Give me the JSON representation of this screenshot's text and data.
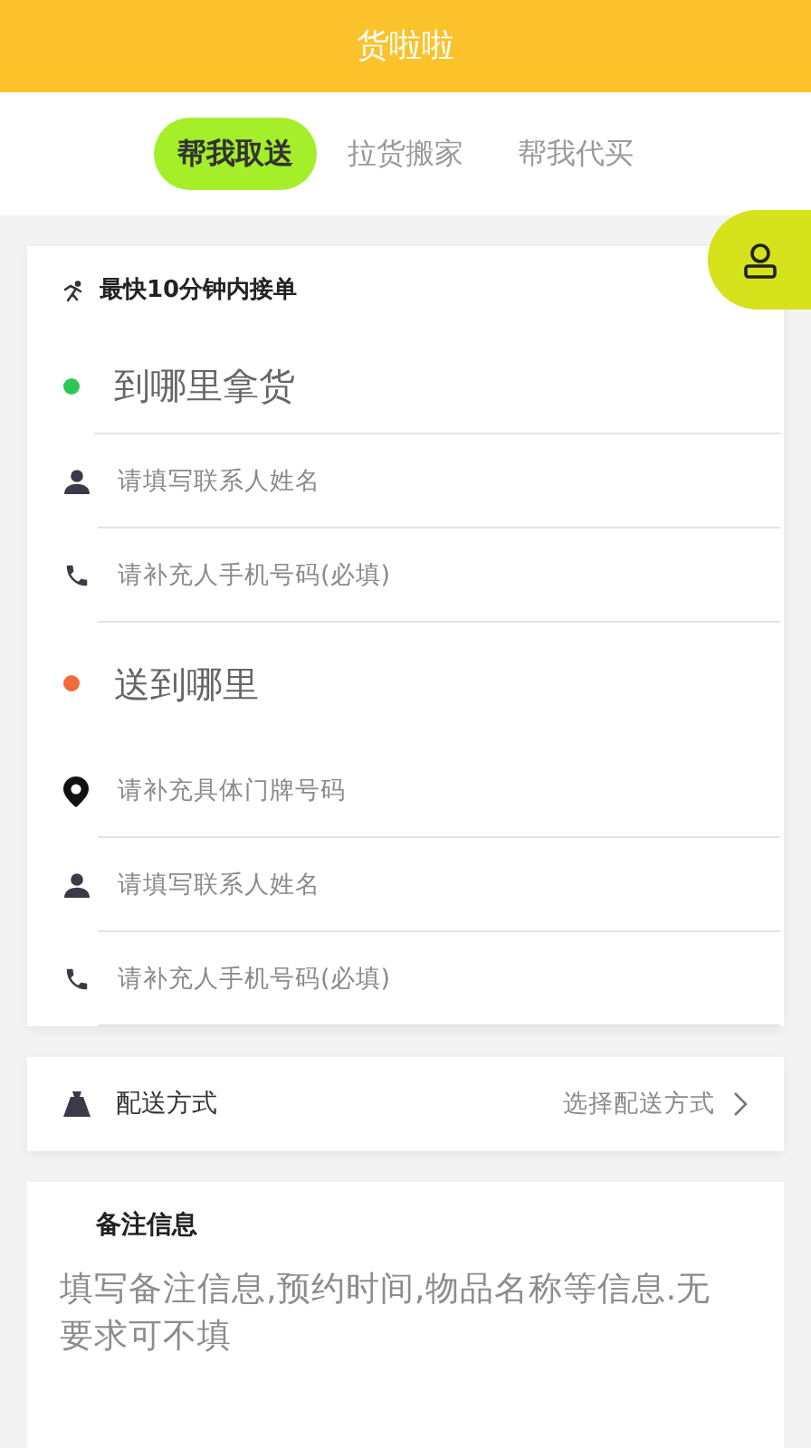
{
  "header": {
    "title": "货啦啦"
  },
  "tabs": [
    {
      "label": "帮我取送",
      "selected": true
    },
    {
      "label": "拉货搬家",
      "selected": false
    },
    {
      "label": "帮我代买",
      "selected": false
    }
  ],
  "order_form": {
    "note": "最快10分钟内接单",
    "sections": [
      {
        "title": "到哪里拿货",
        "color": "#2fc659",
        "divider": true,
        "fields": [
          {
            "kind": "person",
            "placeholder": "请填写联系人姓名"
          },
          {
            "kind": "phone",
            "placeholder": "请补充人手机号码(必填)"
          }
        ]
      },
      {
        "title": "送到哪里",
        "color": "#f26b3a",
        "divider": false,
        "fields": [
          {
            "kind": "location",
            "placeholder": "请补充具体门牌号码"
          },
          {
            "kind": "person",
            "placeholder": "请填写联系人姓名"
          },
          {
            "kind": "phone",
            "placeholder": "请补充人手机号码(必填)"
          }
        ]
      }
    ]
  },
  "delivery": {
    "label": "配送方式",
    "value": "选择配送方式"
  },
  "remarks": {
    "title": "备注信息",
    "placeholder": "填写备注信息,预约时间,物品名称等信息.无要求可不填"
  }
}
